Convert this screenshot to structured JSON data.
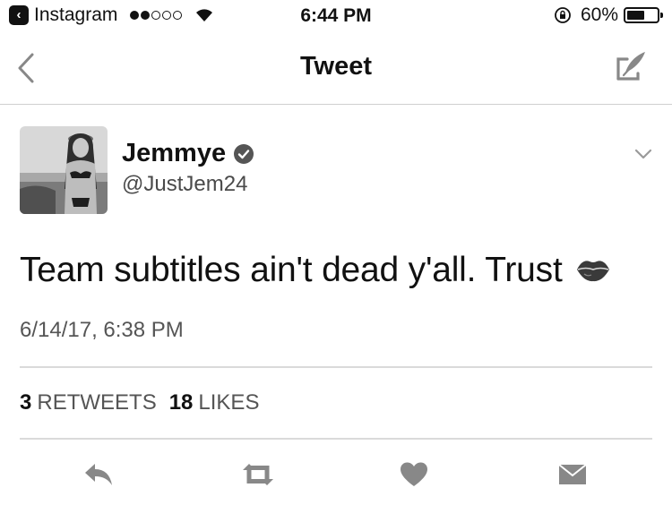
{
  "status_bar": {
    "app_back_label": "Instagram",
    "time": "6:44 PM",
    "battery_percent": "60%",
    "battery_level": 0.6,
    "signal_bars_filled": 2,
    "signal_bars_total": 5
  },
  "nav": {
    "title": "Tweet",
    "back_icon": "chevron-left-icon",
    "compose_icon": "compose-tweet-icon"
  },
  "tweet": {
    "author_name": "Jemmye",
    "handle": "@JustJem24",
    "text": "Team subtitles ain't dead y'all. Trust",
    "emoji_icon": "kiss-mark-icon",
    "timestamp": "6/14/17, 6:38 PM",
    "retweet_count": "3",
    "retweet_label": "RETWEETS",
    "like_count": "18",
    "like_label": "LIKES"
  },
  "actions": [
    "reply-icon",
    "retweet-icon",
    "like-icon",
    "direct-message-icon"
  ]
}
